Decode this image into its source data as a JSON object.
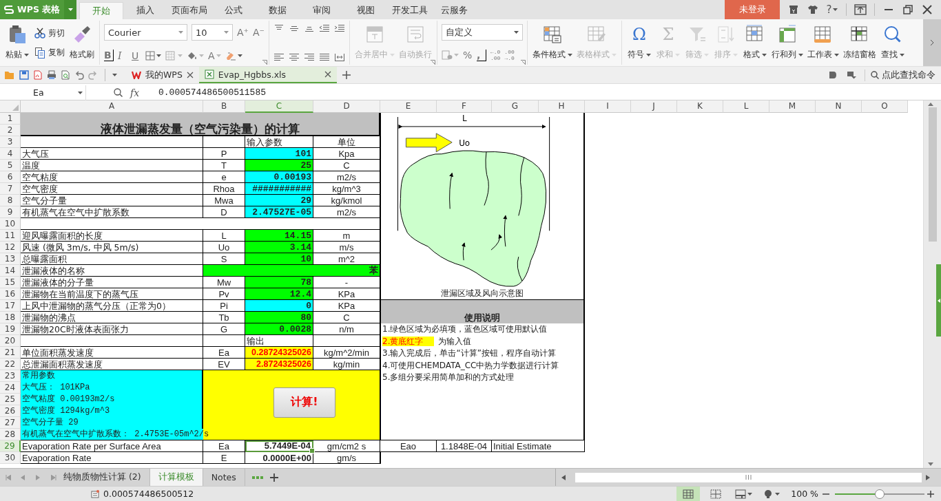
{
  "app": {
    "name": "WPS 表格",
    "login": "未登录",
    "help": "?"
  },
  "menu_tabs": [
    {
      "label": "开始",
      "selected": true
    },
    {
      "label": "插入",
      "selected": false
    },
    {
      "label": "页面布局",
      "selected": false
    },
    {
      "label": "公式",
      "selected": false
    },
    {
      "label": "数据",
      "selected": false
    },
    {
      "label": "审阅",
      "selected": false
    },
    {
      "label": "视图",
      "selected": false
    },
    {
      "label": "开发工具",
      "selected": false
    },
    {
      "label": "云服务",
      "selected": false
    }
  ],
  "clipboard": {
    "paste": "粘贴",
    "cut": "剪切",
    "copy": "复制",
    "format_painter": "格式刷"
  },
  "font": {
    "name": "Courier",
    "size": "10",
    "grow": "A⁺",
    "shrink": "A⁻",
    "bold": "B",
    "italic": "I",
    "underline": "U",
    "font_color": "A"
  },
  "alignment": [
    {
      "label": "合并居中",
      "kind": "merge",
      "dropdown": true,
      "disabled": true
    },
    {
      "label": "自动换行",
      "kind": "wrap",
      "dropdown": false,
      "disabled": true
    }
  ],
  "number_format": {
    "value": "自定义",
    "percent": "%",
    "comma": ",",
    "decimals": [
      {
        "top": "←.0",
        "bottom": ".00"
      },
      {
        "top": ".00",
        "bottom": "→.0"
      }
    ]
  },
  "styles": [
    {
      "label": "条件格式",
      "kind": "conditional",
      "dropdown": true,
      "disabled": false
    },
    {
      "label": "表格样式",
      "kind": "table_style",
      "dropdown": true,
      "disabled": true
    }
  ],
  "tools": [
    {
      "label": "符号",
      "kind": "symbol",
      "glyph": "Ω",
      "dropdown": true,
      "disabled": false
    },
    {
      "label": "求和",
      "kind": "sum",
      "glyph": "Σ",
      "dropdown": true,
      "disabled": true
    },
    {
      "label": "筛选",
      "kind": "filter",
      "dropdown": true,
      "disabled": true
    },
    {
      "label": "排序",
      "kind": "sort",
      "dropdown": true,
      "disabled": true
    },
    {
      "label": "格式",
      "kind": "format",
      "dropdown": true,
      "disabled": false
    },
    {
      "label": "行和列",
      "kind": "rows_cols",
      "dropdown": true,
      "disabled": false
    },
    {
      "label": "工作表",
      "kind": "sheet",
      "dropdown": true,
      "disabled": false
    },
    {
      "label": "冻结窗格",
      "kind": "freeze",
      "dropdown": false,
      "disabled": false
    },
    {
      "label": "查找",
      "kind": "find",
      "dropdown": true,
      "disabled": false
    }
  ],
  "doc_tabs": [
    {
      "label": "我的WPS",
      "kind": "home",
      "selected": false
    },
    {
      "label": "Evap_Hgbbs.xls",
      "kind": "sheet",
      "selected": true
    }
  ],
  "command_search": {
    "placeholder": "点此查找命令"
  },
  "formula_bar": {
    "name_box": "Ea",
    "fx": "fx",
    "value": "0.000574486500511585"
  },
  "columns": [
    {
      "label": "A",
      "selected": false
    },
    {
      "label": "B",
      "selected": false
    },
    {
      "label": "C",
      "selected": true
    },
    {
      "label": "D",
      "selected": false
    },
    {
      "label": "E",
      "selected": false
    },
    {
      "label": "F",
      "selected": false
    },
    {
      "label": "G",
      "selected": false
    },
    {
      "label": "H",
      "selected": false
    },
    {
      "label": "I",
      "selected": false
    },
    {
      "label": "J",
      "selected": false
    },
    {
      "label": "K",
      "selected": false
    },
    {
      "label": "L",
      "selected": false
    },
    {
      "label": "M",
      "selected": false
    },
    {
      "label": "N",
      "selected": false
    },
    {
      "label": "O",
      "selected": false
    }
  ],
  "rows": [
    {
      "label": "1",
      "selected": false
    },
    {
      "label": "2",
      "selected": false
    },
    {
      "label": "3",
      "selected": false
    },
    {
      "label": "4",
      "selected": false
    },
    {
      "label": "5",
      "selected": false
    },
    {
      "label": "6",
      "selected": false
    },
    {
      "label": "7",
      "selected": false
    },
    {
      "label": "8",
      "selected": false
    },
    {
      "label": "9",
      "selected": false
    },
    {
      "label": "10",
      "selected": false
    },
    {
      "label": "11",
      "selected": false
    },
    {
      "label": "12",
      "selected": false
    },
    {
      "label": "13",
      "selected": false
    },
    {
      "label": "14",
      "selected": false
    },
    {
      "label": "15",
      "selected": false
    },
    {
      "label": "16",
      "selected": false
    },
    {
      "label": "17",
      "selected": false
    },
    {
      "label": "18",
      "selected": false
    },
    {
      "label": "19",
      "selected": false
    },
    {
      "label": "20",
      "selected": false
    },
    {
      "label": "21",
      "selected": false
    },
    {
      "label": "22",
      "selected": false
    },
    {
      "label": "23",
      "selected": false
    },
    {
      "label": "24",
      "selected": false
    },
    {
      "label": "25",
      "selected": false
    },
    {
      "label": "26",
      "selected": false
    },
    {
      "label": "27",
      "selected": false
    },
    {
      "label": "28",
      "selected": false
    },
    {
      "label": "29",
      "selected": true
    },
    {
      "label": "30",
      "selected": false
    }
  ],
  "sheet": {
    "title": "液体泄漏蒸发量（空气污染量）的计算",
    "header": {
      "input": "输入参数",
      "unit": "单位"
    },
    "air_params": [
      {
        "name": "大气压",
        "symbol": "P",
        "value": "101",
        "unit": "Kpa",
        "color": "#00ffff"
      },
      {
        "name": "温度",
        "symbol": "T",
        "value": "25",
        "unit": "C",
        "color": "#00ff00"
      },
      {
        "name": "空气粘度",
        "symbol": "e",
        "value": "0.00193",
        "unit": "m2/s",
        "color": "#00ffff"
      },
      {
        "name": "空气密度",
        "symbol": "Rhoa",
        "value": "###########",
        "unit": "kg/m^3",
        "color": "#00ffff"
      },
      {
        "name": "空气分子量",
        "symbol": "Mwa",
        "value": "29",
        "unit": "kg/kmol",
        "color": "#00ffff"
      },
      {
        "name": "有机蒸气在空气中扩散系数",
        "symbol": "D",
        "value": "2.47527E-05",
        "unit": "m2/s",
        "color": "#00ffff"
      }
    ],
    "leak_params": [
      {
        "name": "迎风曝露面积的长度",
        "symbol": "L",
        "value": "14.15",
        "unit": "m",
        "color": "#00ff00"
      },
      {
        "name": "风速 (微风 3m/s, 中风 5m/s)",
        "symbol": "Uo",
        "value": "3.14",
        "unit": "m/s",
        "color": "#00ff00"
      },
      {
        "name": "总曝露面积",
        "symbol": "S",
        "value": "10",
        "unit": "m^2",
        "color": "#00ff00"
      },
      {
        "name": "泄漏液体的名称",
        "kind": "merged",
        "value": "苯",
        "color": "#00ff00"
      },
      {
        "name": "泄漏液体的分子量",
        "symbol": "Mw",
        "value": "78",
        "unit": "-",
        "color": "#00ff00"
      },
      {
        "name": "泄漏物在当前温度下的蒸气压",
        "symbol": "Pv",
        "value": "12.4",
        "unit": "KPa",
        "color": "#00ff00"
      },
      {
        "name": "上风中泄漏物的蒸气分压（正常为0）",
        "symbol": "Pi",
        "value": "0",
        "unit": "KPa",
        "color": "#00ffff"
      },
      {
        "name": "泄漏物的沸点",
        "symbol": "Tb",
        "value": "80",
        "unit": "C",
        "color": "#00ff00"
      },
      {
        "name": "泄漏物20C时液体表面张力",
        "symbol": "G",
        "value": "0.0028",
        "unit": "n/m",
        "color": "#00ff00"
      }
    ],
    "output_header": "输出",
    "outputs": [
      {
        "name": "单位面积蒸发速度",
        "symbol": "Ea",
        "value": "0.28724325026",
        "unit": "kg/m^2/min"
      },
      {
        "name": "总泄漏面积蒸发速度",
        "symbol": "EV",
        "value": "2.8724325026",
        "unit": "kg/min"
      }
    ],
    "common_params": [
      "常用参数",
      "大气压： 101KPa",
      "空气粘度 0.00193m2/s",
      "空气密度 1294kg/m^3",
      "空气分子量 29",
      "有机蒸气在空气中扩散系数： 2.4753E-05m^2/s"
    ],
    "calc_button": "计算!",
    "results": [
      {
        "name": "Evaporation Rate per Surface Area",
        "symbol": "Ea",
        "value": "5.7449E-04",
        "unit": "gm/cm2 s",
        "selected": true,
        "extra": {
          "label": "Eao",
          "value": "1.1848E-04",
          "note": "Initial Estimate"
        }
      },
      {
        "name": "Evaporation Rate",
        "symbol": "E",
        "value": "0.0000E+00",
        "unit": "gm/s",
        "selected": false
      }
    ],
    "diagram": {
      "length_label": "L",
      "wind_label": "Uo",
      "caption": "泄漏区域及风向示意图"
    },
    "instructions": {
      "title": "使用说明",
      "lines": [
        {
          "text": "1.绿色区域为必填项，蓝色区域可使用默认值"
        },
        {
          "highlight": "2.黄底红字",
          "text": "为输入值"
        },
        {
          "text": "3.输入完成后，单击“计算”按钮，程序自动计算"
        },
        {
          "text": "4.可使用CHEMDATA_CC中热力学数据进行计算"
        },
        {
          "text": "5.多组分要采用简单加和的方式处理"
        }
      ]
    }
  },
  "sheet_tabs": [
    {
      "label": "纯物质物性计算 (2)",
      "selected": false
    },
    {
      "label": "计算模板",
      "selected": true
    },
    {
      "label": "Notes",
      "selected": false
    }
  ],
  "status_bar": {
    "value": "0.000574486500512",
    "zoom": "100 %",
    "views": [
      {
        "kind": "normal",
        "selected": true
      },
      {
        "kind": "page_break",
        "selected": false
      },
      {
        "kind": "layout",
        "selected": false
      },
      {
        "kind": "reading",
        "selected": false
      }
    ],
    "zoom_slider": {
      "level": 0.5
    }
  }
}
